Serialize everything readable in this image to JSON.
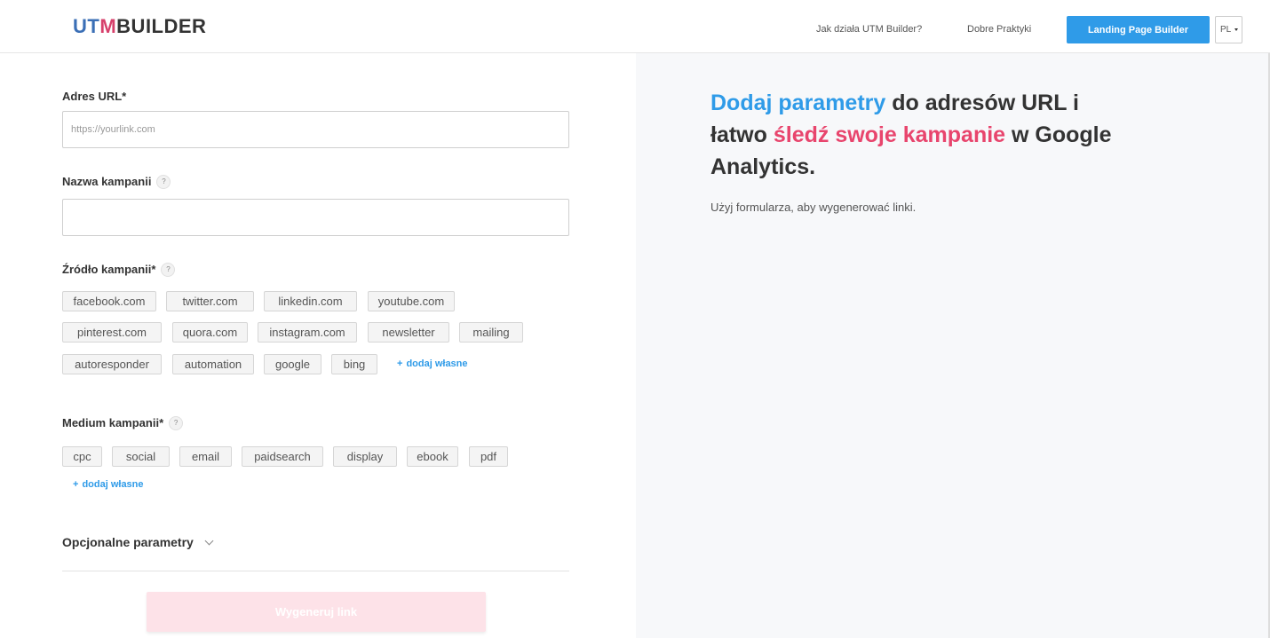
{
  "header": {
    "logo": {
      "u": "U",
      "t": "T",
      "m": "M",
      "rest": "BUILDER"
    },
    "nav_how": "Jak działa UTM Builder?",
    "nav_practice": "Dobre Praktyki",
    "lp_button": "Landing Page Builder",
    "lang": "PL"
  },
  "form": {
    "url_label": "Adres URL*",
    "url_placeholder": "https://yourlink.com",
    "campaign_label": "Nazwa kampanii",
    "source_label": "Źródło kampanii*",
    "sources": [
      "facebook.com",
      "twitter.com",
      "linkedin.com",
      "youtube.com",
      "pinterest.com",
      "quora.com",
      "instagram.com",
      "newsletter",
      "mailing",
      "autoresponder",
      "automation",
      "google",
      "bing"
    ],
    "add_own": "dodaj własne",
    "medium_label": "Medium kampanii*",
    "mediums": [
      "cpc",
      "social",
      "email",
      "paidsearch",
      "display",
      "ebook",
      "pdf"
    ],
    "optional": "Opcjonalne parametry",
    "generate": "Wygeneruj link",
    "help": "?"
  },
  "hero": {
    "part1": "Dodaj parametry",
    "part2": " do adresów URL i łatwo ",
    "part3": "śledź swoje kampanie",
    "part4": " w Google Analytics.",
    "subtext": "Użyj formularza, aby wygenerować linki."
  },
  "colors": {
    "accent_blue": "#2f9be8",
    "accent_pink": "#e8456d"
  }
}
